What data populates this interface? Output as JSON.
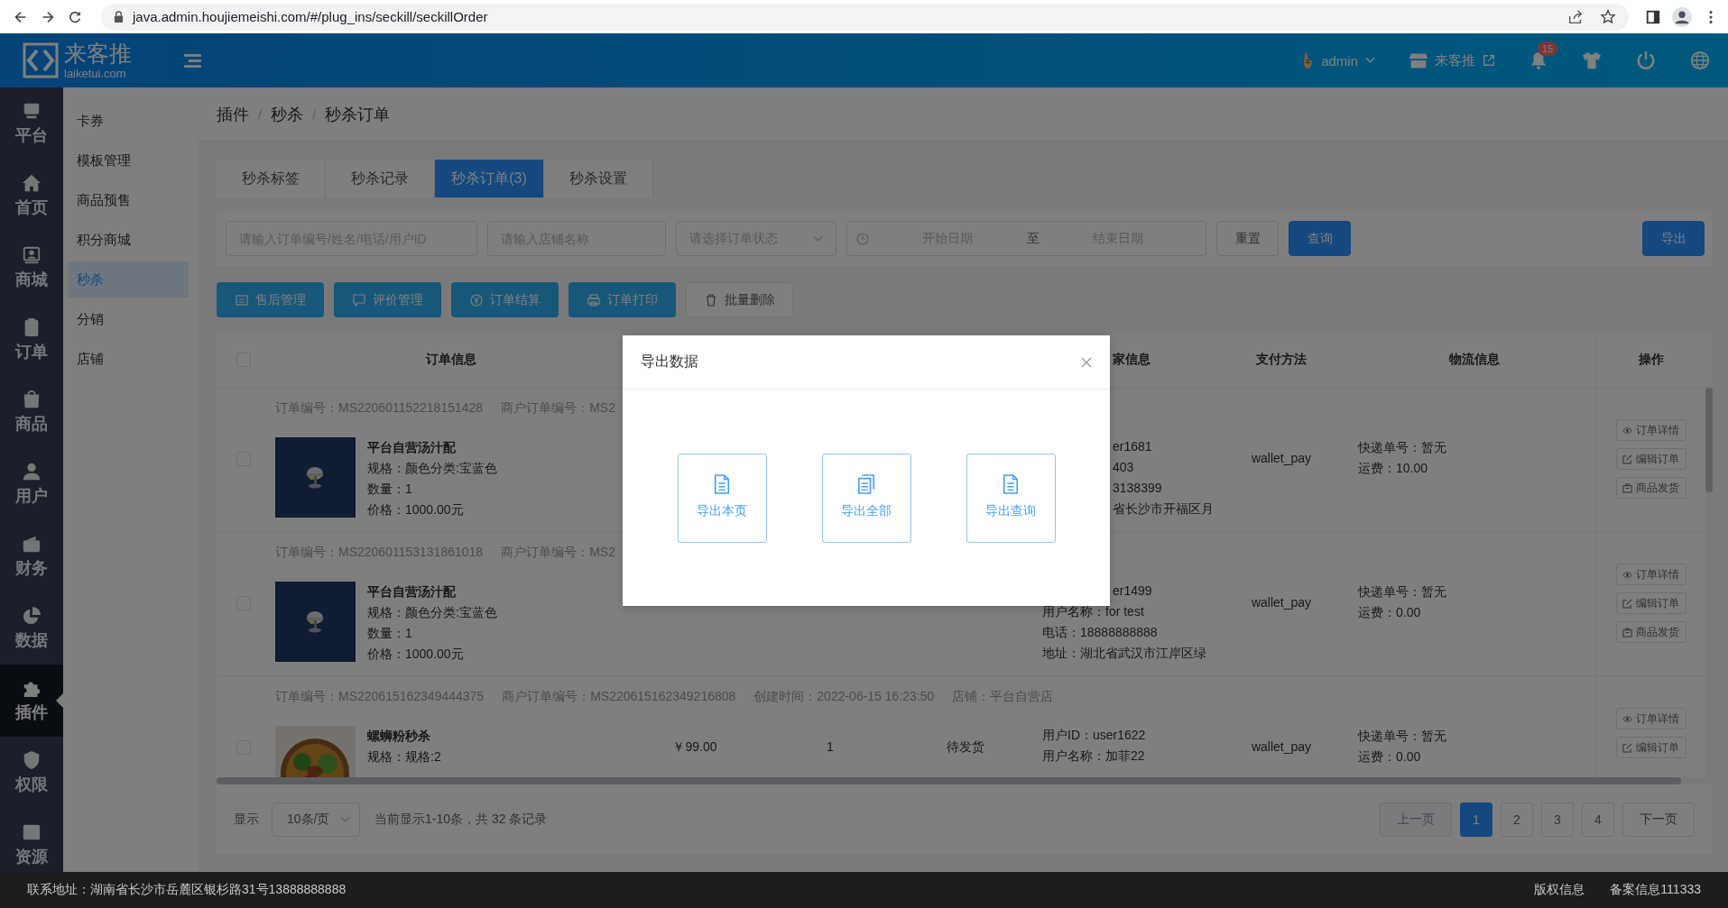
{
  "browser": {
    "url": "java.admin.houjiemeishi.com/#/plug_ins/seckill/seckillOrder"
  },
  "header": {
    "logo_title": "来客推",
    "logo_subtitle": "laiketui.com",
    "user": "admin",
    "store": "来客推",
    "notification_count": "15"
  },
  "nav": [
    {
      "label": "平台",
      "selected": false
    },
    {
      "label": "首页",
      "selected": false
    },
    {
      "label": "商城",
      "selected": false
    },
    {
      "label": "订单",
      "selected": false
    },
    {
      "label": "商品",
      "selected": false
    },
    {
      "label": "用户",
      "selected": false
    },
    {
      "label": "财务",
      "selected": false
    },
    {
      "label": "数据",
      "selected": false
    },
    {
      "label": "插件",
      "selected": true
    },
    {
      "label": "权限",
      "selected": false
    },
    {
      "label": "资源",
      "selected": false
    }
  ],
  "submenu": [
    {
      "label": "卡券",
      "selected": false
    },
    {
      "label": "模板管理",
      "selected": false
    },
    {
      "label": "商品预售",
      "selected": false
    },
    {
      "label": "积分商城",
      "selected": false
    },
    {
      "label": "秒杀",
      "selected": true
    },
    {
      "label": "分销",
      "selected": false
    },
    {
      "label": "店铺",
      "selected": false
    }
  ],
  "breadcrumb": [
    {
      "label": "插件",
      "separator": "/"
    },
    {
      "label": "秒杀",
      "separator": "/"
    },
    {
      "label": "秒杀订单"
    }
  ],
  "tabs": [
    {
      "label": "秒杀标签",
      "selected": false
    },
    {
      "label": "秒杀记录",
      "selected": false
    },
    {
      "label": "秒杀订单(3)",
      "selected": true
    },
    {
      "label": "秒杀设置",
      "selected": false
    }
  ],
  "filters": {
    "order_search": {
      "placeholder": "请输入订单编号/姓名/电话/用户ID"
    },
    "shop_search": {
      "placeholder": "请输入店铺名称"
    },
    "status": {
      "placeholder": "请选择订单状态"
    },
    "date_range": {
      "start_placeholder": "开始日期",
      "separator": "至",
      "end_placeholder": "结束日期"
    },
    "reset": "重置",
    "query": "查询",
    "export": "导出"
  },
  "actions": [
    {
      "label": "售后管理",
      "kind": "primary"
    },
    {
      "label": "评价管理",
      "kind": "primary"
    },
    {
      "label": "订单结算",
      "kind": "primary"
    },
    {
      "label": "订单打印",
      "kind": "primary"
    },
    {
      "label": "批量删除",
      "kind": "plain"
    }
  ],
  "table": {
    "all_checked": false,
    "columns": {
      "order_info": "订单信息",
      "buyer": "家信息",
      "payment": "支付方法",
      "logistics": "物流信息",
      "operations": "操作"
    },
    "rows": [
      {
        "checked": false,
        "meta": [
          "订单编号：MS220601152218151428",
          "商户订单编号：MS2"
        ],
        "product": {
          "name": "平台自营汤汁配",
          "lines": [
            "规格：颜色分类:宝蓝色",
            "数量：1",
            "价格：1000.00元"
          ]
        },
        "buyer": [
          {
            "text": "er1681",
            "covered": true
          },
          {
            "text": "403",
            "covered": true
          },
          {
            "text": "3138399",
            "covered": true
          },
          {
            "text": "省长沙市开福区月",
            "covered": true
          }
        ],
        "payment": "wallet_pay",
        "logistics": [
          "快递单号：暂无",
          "运费：10.00"
        ],
        "operations": [
          "订单详情",
          "编辑订单",
          "商品发货"
        ]
      },
      {
        "checked": false,
        "meta": [
          "订单编号：MS220601153131861018",
          "商户订单编号：MS2"
        ],
        "product": {
          "name": "平台自营汤汁配",
          "lines": [
            "规格：颜色分类:宝蓝色",
            "数量：1",
            "价格：1000.00元"
          ]
        },
        "buyer": [
          {
            "text": "er1499",
            "covered": true
          },
          {
            "text": "用户名称：for test",
            "covered": false
          },
          {
            "text": "电话：18888888888",
            "covered": false
          },
          {
            "text": "地址：湖北省武汉市江岸区绿",
            "covered": false
          }
        ],
        "payment": "wallet_pay",
        "logistics": [
          "快递单号：暂无",
          "运费：0.00"
        ],
        "operations": [
          "订单详情",
          "编辑订单",
          "商品发货"
        ]
      },
      {
        "checked": false,
        "meta": [
          "订单编号：MS220615162349444375",
          "商户订单编号：MS220615162349216808",
          "创建时间：2022-06-15 16:23:50",
          "店铺：平台自营店"
        ],
        "product": {
          "name": "螺蛳粉秒杀",
          "lines": [
            "规格：规格:2"
          ]
        },
        "price": "￥99.00",
        "quantity": "1",
        "status": "待发货",
        "buyer": [
          {
            "text": "用户ID：user1622",
            "covered": false
          },
          {
            "text": "用户名称：加菲22",
            "covered": false
          }
        ],
        "payment": "wallet_pay",
        "logistics": [
          "快递单号：暂无",
          "运费：0.00"
        ],
        "operations": [
          "订单详情",
          "编辑订单"
        ]
      }
    ]
  },
  "pagination": {
    "size_label": "显示",
    "page_size": "10条/页",
    "summary": "当前显示1-10条，共 32 条记录",
    "prev": {
      "label": "上一页",
      "disabled": true
    },
    "pages": [
      {
        "label": "1",
        "selected": true
      },
      {
        "label": "2",
        "selected": false
      },
      {
        "label": "3",
        "selected": false
      },
      {
        "label": "4",
        "selected": false
      }
    ],
    "next": {
      "label": "下一页",
      "disabled": false
    }
  },
  "footer": {
    "address": "联系地址：湖南省长沙市岳麓区银杉路31号13888888888",
    "links": [
      "版权信息",
      "备案信息111333"
    ]
  },
  "dialog": {
    "title": "导出数据",
    "options": [
      "导出本页",
      "导出全部",
      "导出查询"
    ]
  }
}
